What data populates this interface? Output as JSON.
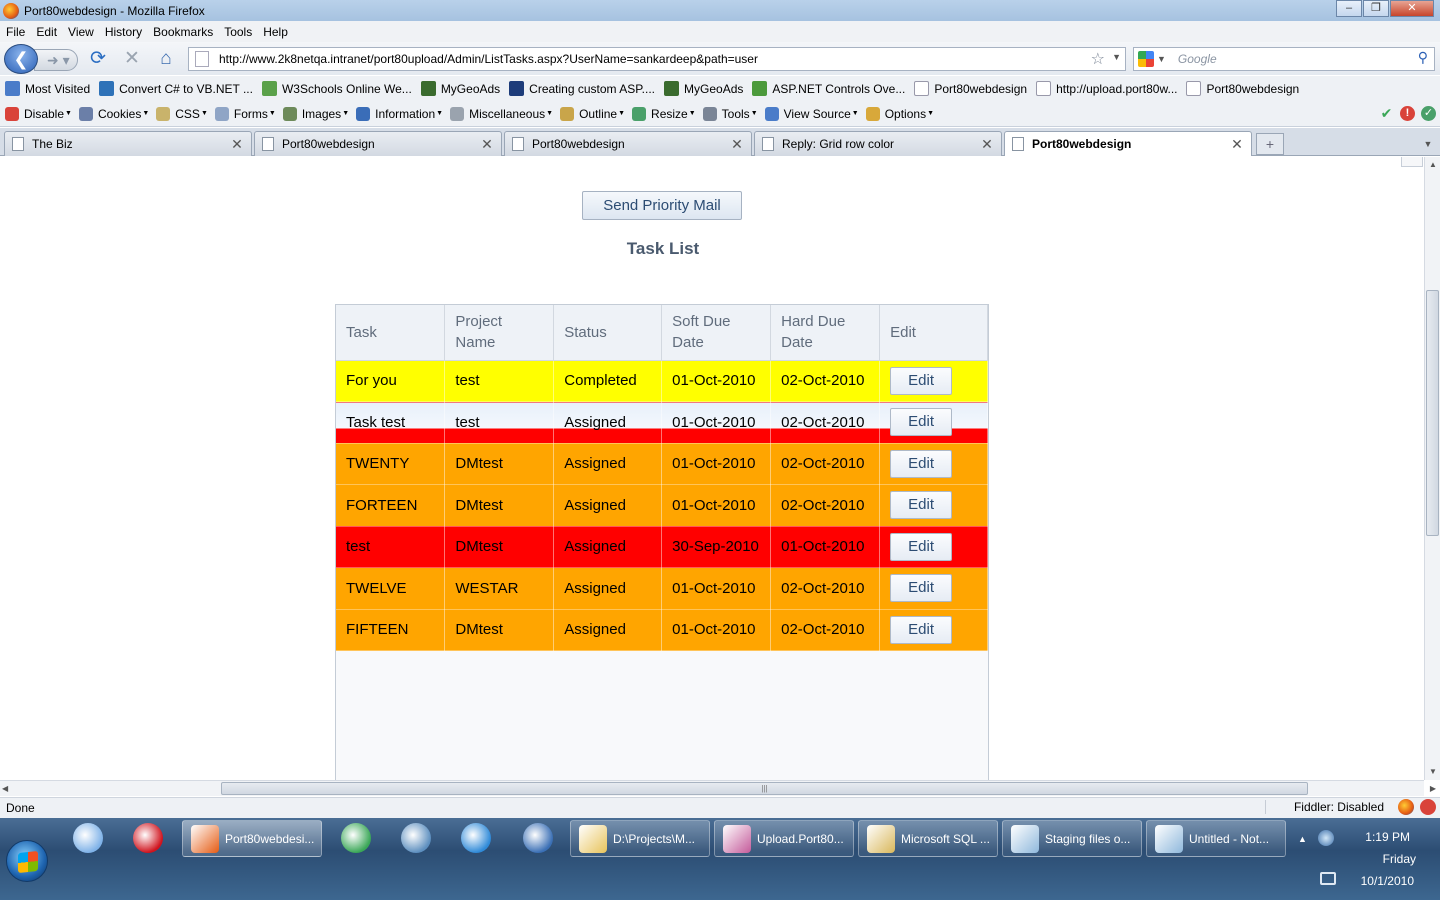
{
  "window": {
    "title": "Port80webdesign - Mozilla Firefox"
  },
  "menu": [
    "File",
    "Edit",
    "View",
    "History",
    "Bookmarks",
    "Tools",
    "Help"
  ],
  "navbar": {
    "url": "http://www.2k8netqa.intranet/port80upload/Admin/ListTasks.aspx?UserName=sankardeep&path=user",
    "search_placeholder": "Google"
  },
  "bookmarks": [
    {
      "label": "Most Visited",
      "icon": "most-visited-icon",
      "color": "#4a7cc9"
    },
    {
      "label": "Convert C# to VB.NET ...",
      "icon": "convert-icon",
      "color": "#2e72b8"
    },
    {
      "label": "W3Schools Online We...",
      "icon": "w3schools-icon",
      "color": "#5aa14a"
    },
    {
      "label": "MyGeoAds",
      "icon": "geo-icon",
      "color": "#3a6b2e"
    },
    {
      "label": "Creating custom ASP....",
      "icon": "asp-icon",
      "color": "#1d3c7a"
    },
    {
      "label": "MyGeoAds",
      "icon": "geo-icon",
      "color": "#3a6b2e"
    },
    {
      "label": "ASP.NET Controls Ove...",
      "icon": "aspnet-icon",
      "color": "#4c9a3c"
    },
    {
      "label": "Port80webdesign",
      "icon": "page-icon",
      "color": "#ffffff"
    },
    {
      "label": "http://upload.port80w...",
      "icon": "page-icon",
      "color": "#ffffff"
    },
    {
      "label": "Port80webdesign",
      "icon": "page-icon",
      "color": "#ffffff"
    }
  ],
  "devtools": [
    {
      "label": "Disable",
      "icon": "disable-icon",
      "color": "#d9433a"
    },
    {
      "label": "Cookies",
      "icon": "cookies-icon",
      "color": "#6b7fa8"
    },
    {
      "label": "CSS",
      "icon": "css-icon",
      "color": "#c9b36b"
    },
    {
      "label": "Forms",
      "icon": "forms-icon",
      "color": "#8fa5c6"
    },
    {
      "label": "Images",
      "icon": "images-icon",
      "color": "#6d8a5a"
    },
    {
      "label": "Information",
      "icon": "information-icon",
      "color": "#3a6db8"
    },
    {
      "label": "Miscellaneous",
      "icon": "misc-icon",
      "color": "#9aa3ae"
    },
    {
      "label": "Outline",
      "icon": "outline-icon",
      "color": "#c9a54a"
    },
    {
      "label": "Resize",
      "icon": "resize-icon",
      "color": "#4aa06a"
    },
    {
      "label": "Tools",
      "icon": "tools-icon",
      "color": "#7a8596"
    },
    {
      "label": "View Source",
      "icon": "view-source-icon",
      "color": "#4a7cc9"
    },
    {
      "label": "Options",
      "icon": "options-icon",
      "color": "#d8a83a"
    }
  ],
  "tabs": [
    {
      "label": "The Biz",
      "active": false
    },
    {
      "label": "Port80webdesign",
      "active": false
    },
    {
      "label": "Port80webdesign",
      "active": false
    },
    {
      "label": "Reply: Grid row color",
      "active": false
    },
    {
      "label": "Port80webdesign",
      "active": true
    }
  ],
  "page": {
    "send_button": "Send Priority Mail",
    "title": "Task List",
    "columns": [
      "Task",
      "Project Name",
      "Status",
      "Soft Due Date",
      "Hard Due Date",
      "Edit"
    ],
    "rows": [
      {
        "task": "For you",
        "project": "test",
        "status": "Completed",
        "soft": "01-Oct-2010",
        "hard": "02-Oct-2010",
        "edit": "Edit",
        "bg": "#ffff00",
        "variant": "plain"
      },
      {
        "task": "Task test",
        "project": "test",
        "status": "Assigned",
        "soft": "01-Oct-2010",
        "hard": "02-Oct-2010",
        "edit": "Edit",
        "bg": "#eaf1fa",
        "variant": "split"
      },
      {
        "task": "TWENTY",
        "project": "DMtest",
        "status": "Assigned",
        "soft": "01-Oct-2010",
        "hard": "02-Oct-2010",
        "edit": "Edit",
        "bg": "#ffa500",
        "variant": "plain"
      },
      {
        "task": "FORTEEN",
        "project": "DMtest",
        "status": "Assigned",
        "soft": "01-Oct-2010",
        "hard": "02-Oct-2010",
        "edit": "Edit",
        "bg": "#ffa500",
        "variant": "plain"
      },
      {
        "task": "test",
        "project": "DMtest",
        "status": "Assigned",
        "soft": "30-Sep-2010",
        "hard": "01-Oct-2010",
        "edit": "Edit",
        "bg": "#ff0000",
        "variant": "plain"
      },
      {
        "task": "TWELVE",
        "project": "WESTAR",
        "status": "Assigned",
        "soft": "01-Oct-2010",
        "hard": "02-Oct-2010",
        "edit": "Edit",
        "bg": "#ffa500",
        "variant": "plain"
      },
      {
        "task": "FIFTEEN",
        "project": "DMtest",
        "status": "Assigned",
        "soft": "01-Oct-2010",
        "hard": "02-Oct-2010",
        "edit": "Edit",
        "bg": "#ffa500",
        "variant": "plain"
      }
    ]
  },
  "statusbar": {
    "text": "Done",
    "fiddler": "Fiddler: Disabled"
  },
  "taskbar": {
    "pinned": [
      {
        "name": "safari-icon",
        "color": "#7fb2e8"
      },
      {
        "name": "opera-icon",
        "color": "#d0131d"
      }
    ],
    "pinned2": [
      {
        "name": "chrome-icon",
        "color": "#3aa757"
      },
      {
        "name": "network-tool-icon",
        "color": "#5d8fbf"
      },
      {
        "name": "ie-icon",
        "color": "#2f8ad8"
      },
      {
        "name": "thunderbird-icon",
        "color": "#3a6fb5"
      }
    ],
    "windows": [
      {
        "label": "Port80webdesi...",
        "icon": "firefox-icon",
        "color": "#e55b13",
        "active": true
      },
      {
        "label": "D:\\Projects\\M...",
        "icon": "folder-icon",
        "color": "#e8c35a",
        "active": false
      },
      {
        "label": "Upload.Port80...",
        "icon": "vs-icon",
        "color": "#c45a9a",
        "active": false
      },
      {
        "label": "Microsoft SQL ...",
        "icon": "sql-icon",
        "color": "#d9b75a",
        "active": false
      },
      {
        "label": "Staging files o...",
        "icon": "notepad-icon",
        "color": "#8fb8dc",
        "active": false
      },
      {
        "label": "Untitled - Not...",
        "icon": "notepad-icon",
        "color": "#8fb8dc",
        "active": false
      }
    ],
    "time": "1:19 PM",
    "day": "Friday",
    "date": "10/1/2010"
  }
}
